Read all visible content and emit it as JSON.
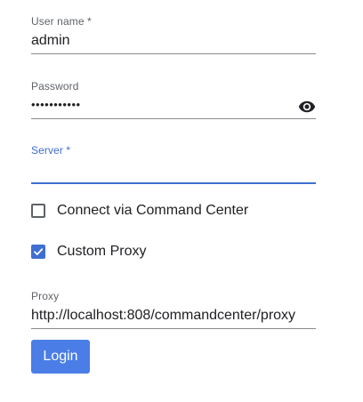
{
  "form": {
    "username": {
      "label": "User name *",
      "value": "admin"
    },
    "password": {
      "label": "Password",
      "value": "•••••••••••",
      "toggle_icon": "eye-icon"
    },
    "server": {
      "label": "Server *",
      "value": "",
      "state": "focused"
    },
    "connect_via_cc": {
      "label": "Connect via Command Center",
      "checked": false
    },
    "custom_proxy": {
      "label": "Custom Proxy",
      "checked": true
    },
    "proxy": {
      "label": "Proxy",
      "value": "http://localhost:808/commandcenter/proxy"
    },
    "login_label": "Login"
  },
  "colors": {
    "accent": "#3f6fd1",
    "button": "#4a7de6",
    "text": "#202124",
    "label": "#5f6368",
    "underline": "#8a8a8a"
  }
}
